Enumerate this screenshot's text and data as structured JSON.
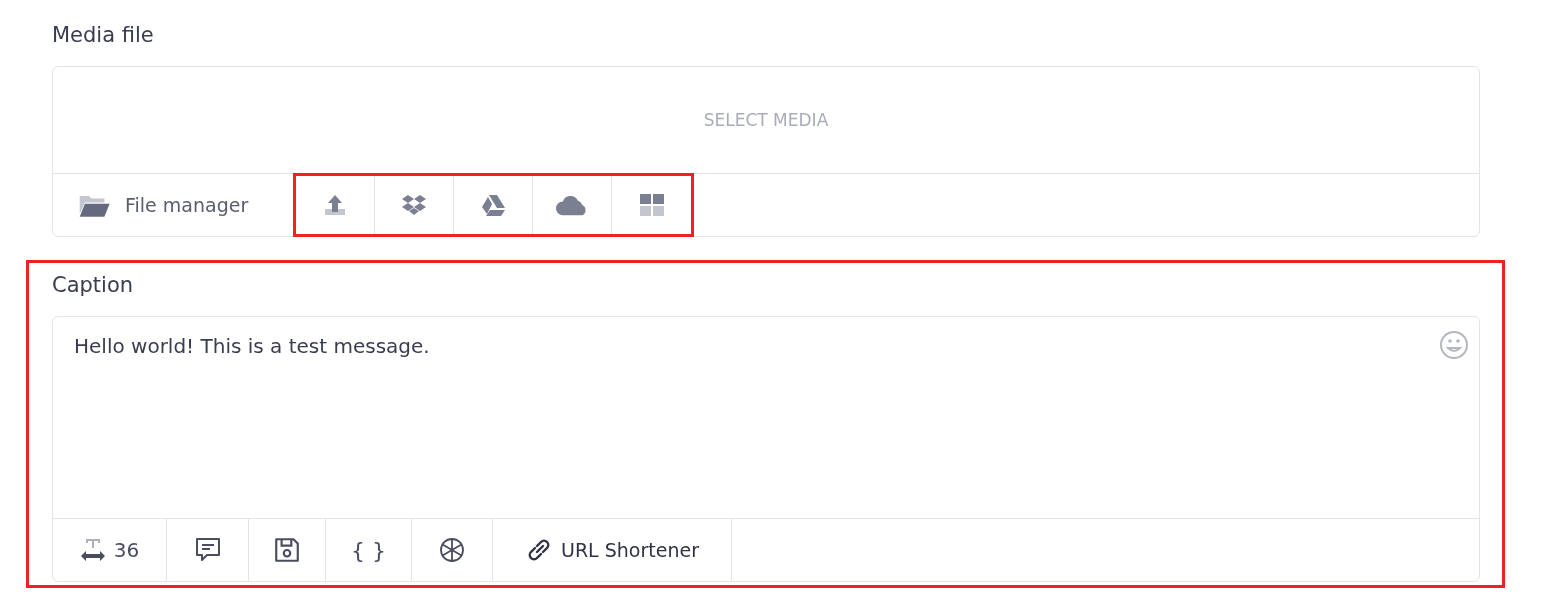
{
  "media_file": {
    "label": "Media file",
    "placeholder": "SELECT MEDIA",
    "file_manager": {
      "label": "File manager"
    },
    "services": {
      "highlighted": true,
      "items": [
        {
          "kind": "upload"
        },
        {
          "kind": "dropbox"
        },
        {
          "kind": "drive"
        },
        {
          "kind": "cloud"
        },
        {
          "kind": "grid"
        }
      ]
    }
  },
  "caption": {
    "highlighted": true,
    "label": "Caption",
    "value": "Hello world! This is a test message.",
    "toolbar": [
      {
        "kind": "counter",
        "label": "36"
      },
      {
        "kind": "comment"
      },
      {
        "kind": "save"
      },
      {
        "kind": "variables",
        "label": "{ }"
      },
      {
        "kind": "ai"
      },
      {
        "kind": "link",
        "label": "URL Shortener"
      }
    ]
  }
}
